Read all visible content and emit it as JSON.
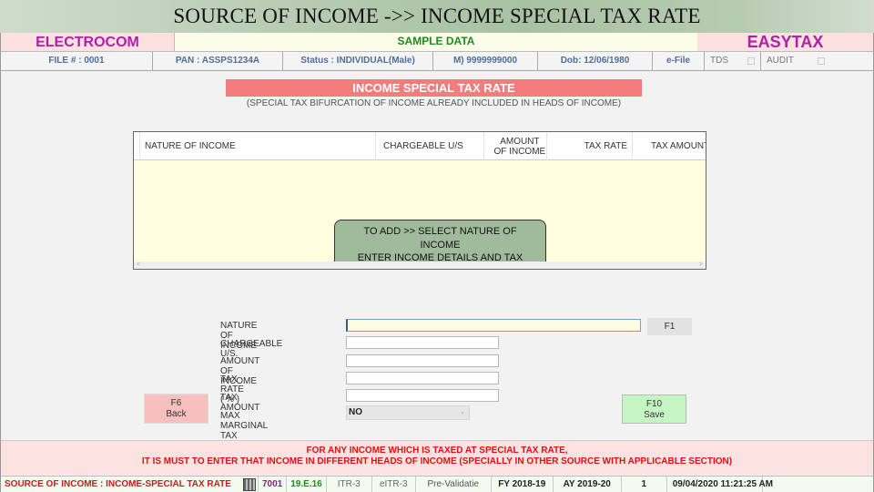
{
  "slide_title": "SOURCE OF INCOME ->> INCOME SPECIAL TAX RATE",
  "brand": {
    "left": "ELECTROCOM",
    "middle": "SAMPLE DATA",
    "right": "EASYTAX"
  },
  "info_bar": {
    "file": "FILE # : 0001",
    "pan": "PAN : ASSPS1234A",
    "status": "Status : INDIVIDUAL(Male)",
    "mobile": "M) 9999999000",
    "dob": "Dob: 12/06/1980",
    "efile": "e-File",
    "tds": "TDS",
    "audit": "AUDIT",
    "check_glyph": "☑"
  },
  "section": {
    "title": "INCOME SPECIAL TAX RATE",
    "subtitle": "(SPECIAL TAX BIFURCATION OF INCOME ALREADY INCLUDED IN HEADS OF INCOME)"
  },
  "grid": {
    "columns": [
      "NATURE OF INCOME",
      "CHARGEABLE U/S",
      "AMOUNT OF INCOME",
      "TAX RATE",
      "TAX AMOUNT"
    ],
    "rows": [],
    "hint": "TO ADD >> SELECT NATURE OF\nINCOME\nENTER INCOME DETAILS AND TAX\nRATE",
    "scroll_left": "<",
    "scroll_right": ">"
  },
  "form": {
    "labels": {
      "nature": "NATURE OF INCOME",
      "chargeable": "CHARGEABLE U/S.",
      "amount": "AMOUNT OF INCOME",
      "rate": "TAX RATE ( % )",
      "tax_amount": "TAX AMOUNT",
      "max_marginal": "MAX MARGINAL TAX"
    },
    "values": {
      "nature": "",
      "chargeable": "",
      "amount": "",
      "rate": "",
      "tax_amount": "",
      "max_marginal": "NO"
    },
    "f1_label": "F1",
    "back_label": "F6\nBack",
    "save_label": "F10\nSave"
  },
  "warning": "FOR ANY INCOME WHICH IS TAXED AT SPECIAL TAX RATE,\nIT IS MUST TO ENTER THAT INCOME IN DIFFERENT HEADS OF INCOME (SPECIALLY IN OTHER SOURCE WITH APPLICABLE SECTION)",
  "status_bar": {
    "title": "SOURCE OF INCOME : INCOME-SPECIAL TAX RATE",
    "code": "7001",
    "version": "19.E.16",
    "itr": "ITR-3",
    "eitr": "eITR-3",
    "prevalidate": "Pre-Validatie",
    "fy": "FY 2018-19",
    "ay": "AY 2019-20",
    "count": "1",
    "datetime": "09/04/2020 11:21:25 AM",
    "indicator": "..",
    "colors": {
      "title": "#c02020",
      "code": "#8a1a8a",
      "version": "#1f8a1f"
    }
  }
}
